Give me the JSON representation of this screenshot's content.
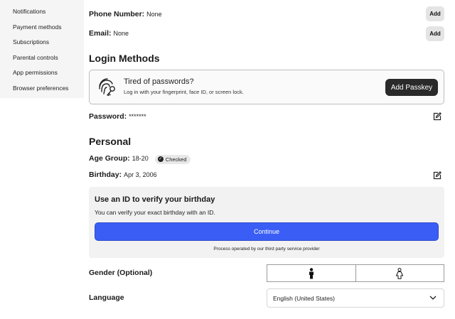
{
  "sidebar": {
    "items": [
      {
        "label": "Notifications"
      },
      {
        "label": "Payment methods"
      },
      {
        "label": "Subscriptions"
      },
      {
        "label": "Parental controls"
      },
      {
        "label": "App permissions"
      },
      {
        "label": "Browser preferences"
      }
    ]
  },
  "contact": {
    "phone_label": "Phone Number:",
    "phone_value": "None",
    "email_label": "Email:",
    "email_value": "None",
    "add_label": "Add"
  },
  "login": {
    "title": "Login Methods",
    "passkey_title": "Tired of passwords?",
    "passkey_subtitle": "Log in with your fingerprint, face ID, or screen lock.",
    "passkey_button": "Add Passkey",
    "password_label": "Password:",
    "password_value": "*******",
    "icons": [
      "fingerprint-key-icon",
      "edit-icon"
    ]
  },
  "personal": {
    "title": "Personal",
    "age_label": "Age Group:",
    "age_value": "18-20",
    "age_badge": "Checked",
    "birthday_label": "Birthday:",
    "birthday_value": "Apr 3, 2006",
    "verify_title": "Use an ID to verify your birthday",
    "verify_subtitle": "You can verify your exact birthday with an ID.",
    "verify_button": "Continue",
    "verify_note": "Process operated by our third party service provider",
    "gender_label": "Gender (Optional)",
    "gender_options": [
      "male-icon",
      "female-icon"
    ],
    "language_label": "Language",
    "language_value": "English (United States)"
  },
  "colors": {
    "accent": "#3a5ef5",
    "dark_button": "#2a2a2a",
    "sidebar_bg": "#f5f5f5",
    "card_bg": "#f2f2f2"
  }
}
